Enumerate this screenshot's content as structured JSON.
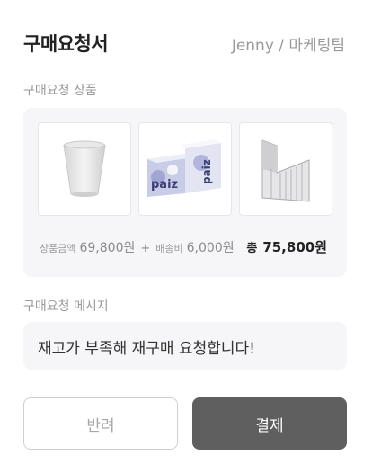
{
  "header": {
    "title": "구매요청서",
    "requester": "Jenny / 마케팅팀"
  },
  "products_section": {
    "label": "구매요청 상품",
    "items": [
      {
        "name": "paper-cup"
      },
      {
        "name": "tissue-box"
      },
      {
        "name": "file-organizer"
      }
    ],
    "price": {
      "product_label": "상품금액",
      "product_amount": "69,800원",
      "plus": "+",
      "shipping_label": "배송비",
      "shipping_amount": "6,000원",
      "total_label": "총",
      "total_amount": "75,800원"
    }
  },
  "message_section": {
    "label": "구매요청 메시지",
    "message": "재고가 부족해 재구매 요청합니다!"
  },
  "actions": {
    "reject_label": "반려",
    "pay_label": "결제"
  }
}
